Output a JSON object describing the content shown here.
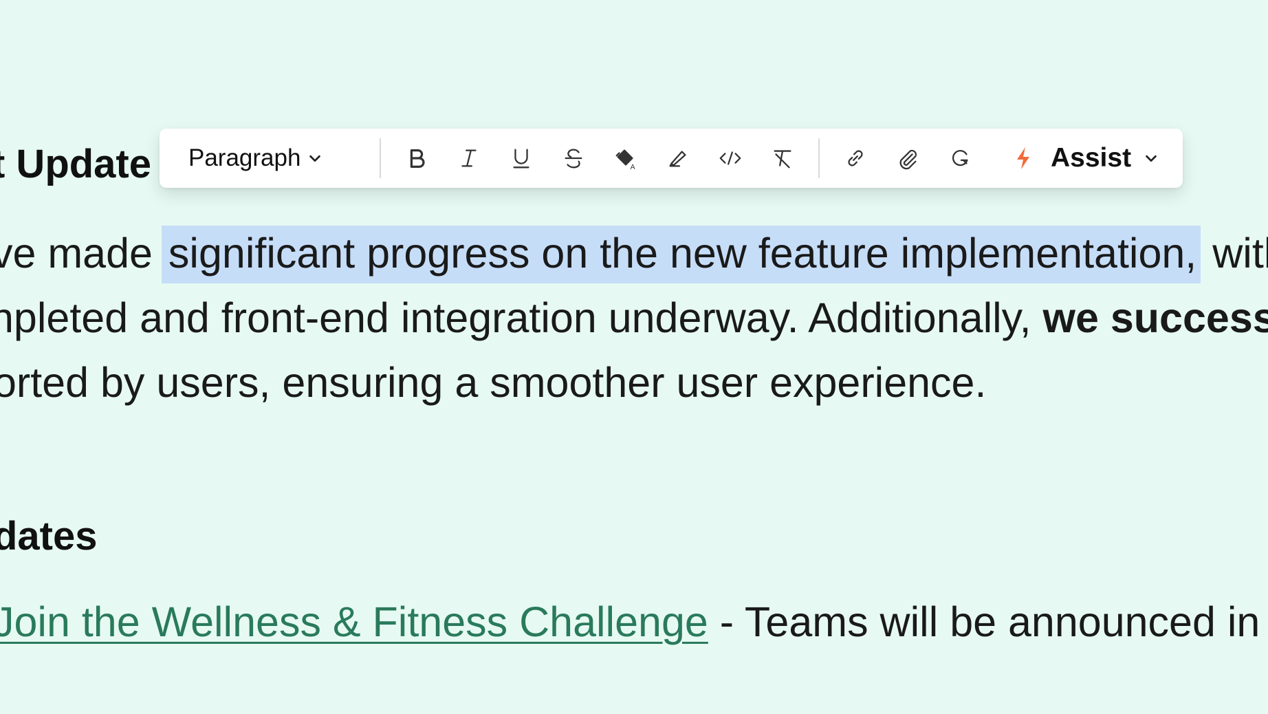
{
  "editor": {
    "heading1_fragment": "t Update",
    "paragraph": {
      "line1_before": "ve made ",
      "line1_selected": "significant progress on the new feature implementation,",
      "line1_after": " with t",
      "line2_normal": "npleted and front-end integration underway. Additionally, ",
      "line2_bold": "we successfu",
      "line3": "orted by users, ensuring a smoother user experience."
    },
    "heading2_fragment": "dates",
    "list_item": {
      "link_text": "Join the Wellness & Fitness Challenge",
      "rest_text": " - Teams will be announced in Sla"
    }
  },
  "toolbar": {
    "block_type_label": "Paragraph",
    "buttons": [
      {
        "name": "bold-button",
        "icon": "bold-icon",
        "glyph": "B"
      },
      {
        "name": "italic-button",
        "icon": "italic-icon",
        "glyph": "I"
      },
      {
        "name": "underline-button",
        "icon": "underline-icon",
        "glyph": "U"
      },
      {
        "name": "strikethrough-button",
        "icon": "strikethrough-icon"
      },
      {
        "name": "text-color-button",
        "icon": "paint-bucket-icon"
      },
      {
        "name": "highlight-button",
        "icon": "highlighter-icon"
      },
      {
        "name": "code-button",
        "icon": "code-icon"
      },
      {
        "name": "clear-format-button",
        "icon": "clear-formatting-icon"
      },
      {
        "name": "link-button",
        "icon": "link-icon"
      },
      {
        "name": "attach-button",
        "icon": "paperclip-icon"
      },
      {
        "name": "grammar-button",
        "icon": "grammarly-icon"
      }
    ],
    "assist_label": "Assist",
    "assist_icon": "lightning-bolt-icon"
  },
  "colors": {
    "background": "#e6faf3",
    "selection": "#c6ddf8",
    "link": "#2a7a5c",
    "assist_bolt": "#f26b3a"
  }
}
